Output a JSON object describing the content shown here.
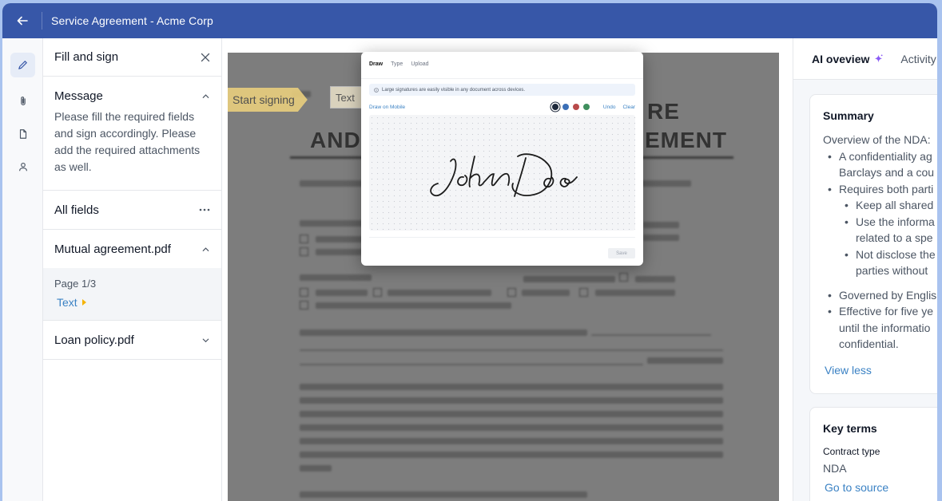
{
  "window": {
    "title": "Service Agreement - Acme Corp"
  },
  "left_panel": {
    "title": "Fill and sign",
    "message_title": "Message",
    "message_text": "Please fill the required fields and sign accordingly. Please add the required attachments as well.",
    "all_fields": "All fields",
    "file1": "Mutual agreement.pdf",
    "page_label": "Page 1/3",
    "field_link": "Text",
    "file2": "Loan policy.pdf"
  },
  "canvas": {
    "start_signing": "Start signing",
    "text_field": "Text"
  },
  "signature_modal": {
    "tabs": [
      "Draw",
      "Type",
      "Upload"
    ],
    "info": "Large signatures are easily visible in any document across devices.",
    "draw_on_mobile": "Draw on Mobile",
    "undo": "Undo",
    "clear": "Clear",
    "colors": [
      "#1e293b",
      "#3b6fb6",
      "#b84a4a",
      "#3f8f5e"
    ],
    "save": "Save"
  },
  "right_panel": {
    "tab_ai": "AI oveview",
    "tab_activity": "Activity",
    "summary": {
      "title": "Summary",
      "intro": "Overview of the NDA:",
      "b1a": "A confidentiality ag",
      "b1b": "Barclays and a cou",
      "b2": "Requires both parti",
      "b2_1": "Keep all shared",
      "b2_2a": "Use the informa",
      "b2_2b": "related to a spe",
      "b2_3a": "Not disclose the",
      "b2_3b": "parties without",
      "b3": "Governed by Englis",
      "b4a": "Effective for five ye",
      "b4b": "until the informatio",
      "b4c": "confidential.",
      "view_less": "View less"
    },
    "key_terms": {
      "title": "Key terms",
      "label": "Contract type",
      "value": "NDA",
      "link": "Go to source"
    }
  }
}
